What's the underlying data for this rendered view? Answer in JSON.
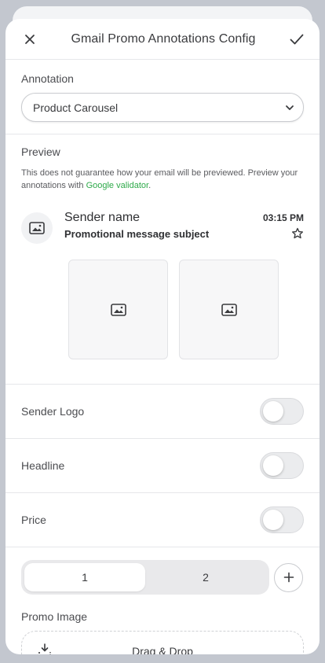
{
  "header": {
    "title": "Gmail Promo Annotations Config"
  },
  "annotation": {
    "label": "Annotation",
    "selected": "Product Carousel"
  },
  "preview": {
    "label": "Preview",
    "note_prefix": "This does not guarantee how your email will be previewed. Preview your annotations with ",
    "note_link": "Google validator",
    "note_suffix": ".",
    "email": {
      "sender": "Sender name",
      "time": "03:15 PM",
      "subject": "Promotional message subject"
    }
  },
  "toggles": [
    {
      "label": "Sender Logo",
      "on": false
    },
    {
      "label": "Headline",
      "on": false
    },
    {
      "label": "Price",
      "on": false
    }
  ],
  "tabs": [
    {
      "label": "1",
      "active": true
    },
    {
      "label": "2",
      "active": false
    }
  ],
  "promo": {
    "label": "Promo Image",
    "dropzone_text": "Drag & Drop"
  },
  "colors": {
    "accent_link": "#2eaa4a",
    "toggle_off": "#ebecee"
  }
}
